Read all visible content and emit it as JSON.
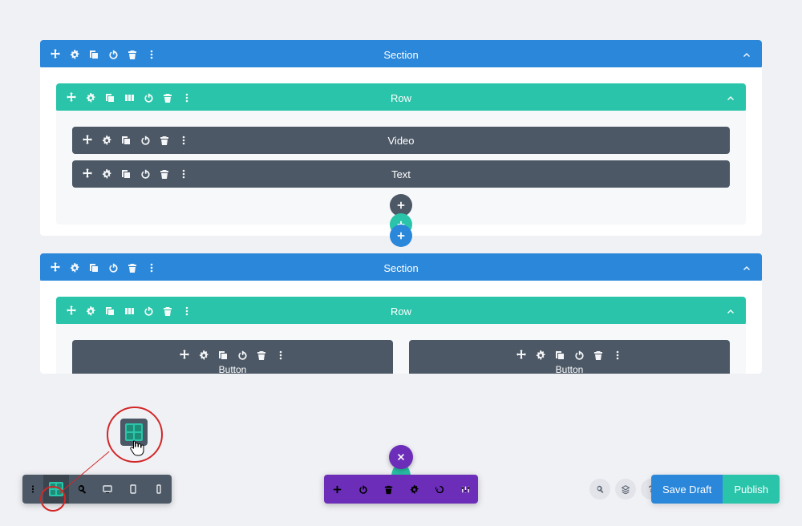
{
  "sections": [
    {
      "label": "Section",
      "rows": [
        {
          "label": "Row",
          "modules": [
            {
              "label": "Video"
            },
            {
              "label": "Text"
            }
          ]
        }
      ]
    },
    {
      "label": "Section",
      "rows": [
        {
          "label": "Row",
          "columns": [
            {
              "label": "Button"
            },
            {
              "label": "Button"
            }
          ]
        }
      ]
    }
  ],
  "bottom": {
    "save_draft": "Save Draft",
    "publish": "Publish",
    "help_glyph": "?"
  },
  "colors": {
    "section": "#2b87da",
    "row": "#29c4a9",
    "module": "#4c5866",
    "purple": "#6c2eb9",
    "annotation": "#d22727"
  }
}
